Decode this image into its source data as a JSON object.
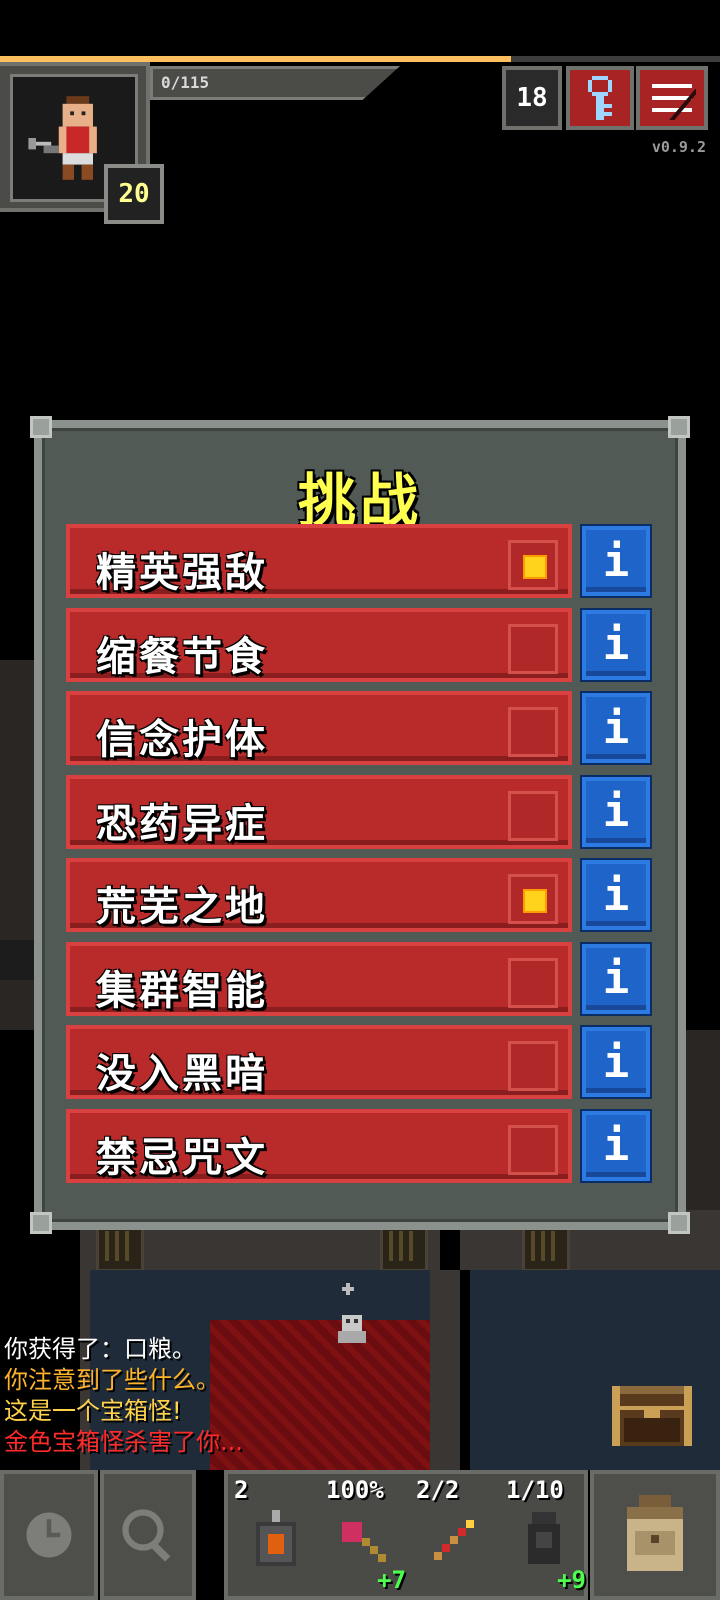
{
  "hud": {
    "hp_text": "0/115",
    "xp_fraction": 0.71,
    "level": "20",
    "depth": "18",
    "version": "v0.9.2"
  },
  "challenge": {
    "title": "挑战",
    "info_glyph": "i",
    "items": [
      {
        "label": "精英强敌",
        "checked": true
      },
      {
        "label": "缩餐节食",
        "checked": false
      },
      {
        "label": "信念护体",
        "checked": false
      },
      {
        "label": "恐药异症",
        "checked": false
      },
      {
        "label": "荒芜之地",
        "checked": true
      },
      {
        "label": "集群智能",
        "checked": false
      },
      {
        "label": "没入黑暗",
        "checked": false
      },
      {
        "label": "禁忌咒文",
        "checked": false
      }
    ]
  },
  "log": [
    {
      "text": "你获得了：口粮。",
      "color": "#ffffff"
    },
    {
      "text": "你注意到了些什么。",
      "color": "#ffb32b"
    },
    {
      "text": "这是一个宝箱怪!",
      "color": "#ffd24a"
    },
    {
      "text": "金色宝箱怪杀害了你...",
      "color": "#ff2a2a"
    }
  ],
  "toolbar": {
    "wait_icon": "clock-icon",
    "search_icon": "magnifier-icon",
    "quickslots": [
      {
        "label": "2",
        "plus": "",
        "icon": "bomb-icon"
      },
      {
        "label": "100%",
        "plus": "+7",
        "icon": "wand-icon"
      },
      {
        "label": "2/2",
        "plus": "",
        "icon": "staff-icon"
      },
      {
        "label": "1/10",
        "plus": "+9",
        "icon": "artifact-icon"
      }
    ],
    "backpack_icon": "backpack-icon"
  }
}
